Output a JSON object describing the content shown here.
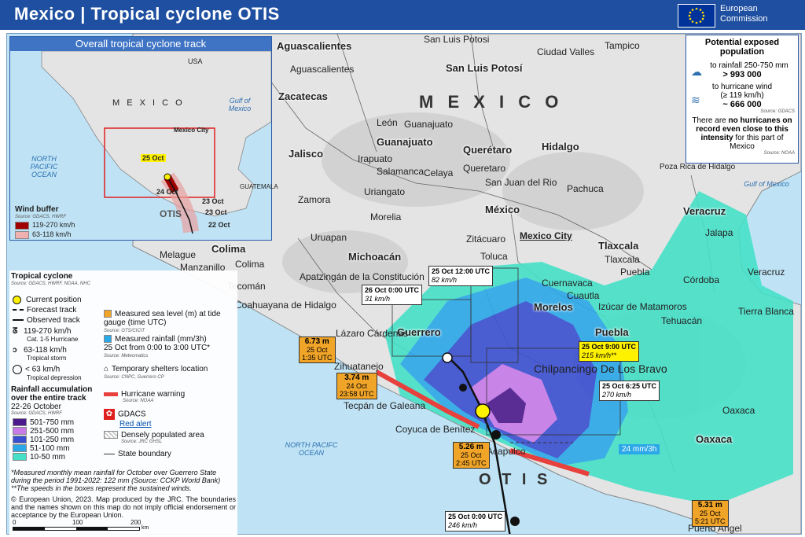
{
  "header": {
    "title": "Mexico | Tropical cyclone  OTIS",
    "eu_line1": "European",
    "eu_line2": "Commission"
  },
  "inset": {
    "title": "Overall tropical cyclone track",
    "country": "M E X I C O",
    "usa": "USA",
    "gulf": "Gulf of Mexico",
    "ocean": "NORTH PACIFIC OCEAN",
    "mexico_city": "Mexico City",
    "guatemala": "GUATEMALA",
    "storm_name": "OTIS",
    "dates": [
      "25 Oct",
      "24 Oct",
      "23 Oct",
      "23 Oct",
      "22 Oct"
    ],
    "wind_title": "Wind buffer",
    "wind_source": "Source: GDACS, HWRF",
    "wind_items": [
      "119-270 km/h",
      "63-118 km/h"
    ]
  },
  "population": {
    "title": "Potential exposed population",
    "rain_label": "to rainfall 250-750 mm",
    "rain_value": "> 993 000",
    "wind_label": "to hurricane wind",
    "wind_sub": "(≥ 119 km/h)",
    "wind_value": "~ 666 000",
    "source1": "Source: GDACS",
    "note1": "There are",
    "note2": "no hurricanes on record even close to this intensity",
    "note3": "for this part of Mexico",
    "source2": "Source: NOAA"
  },
  "map_labels": {
    "country": "M E X I C O",
    "states": [
      "Aguascalientes",
      "San Luis Potosí",
      "Zacatecas",
      "Guanajuato",
      "Querétaro",
      "Hidalgo",
      "Jalisco",
      "Michoacán",
      "México",
      "Tlaxcala",
      "Colima",
      "Morelos",
      "Guerrero",
      "Puebla",
      "Veracruz",
      "Oaxaca"
    ],
    "cities": [
      "San Luis Potosi",
      "Ciudad Valles",
      "Tampico",
      "Aguascalientes",
      "León",
      "Guanajuato",
      "Irapuato",
      "Salamanca",
      "Celaya",
      "Queretaro",
      "San Juan del Rio",
      "Pachuca",
      "Poza Rica de Hidalgo",
      "Zamora",
      "Uriangato",
      "Morelia",
      "Uruapan",
      "Zitácuaro",
      "Toluca",
      "Mexico City",
      "Tlaxcala",
      "Jalapa",
      "Melague",
      "Manzanillo",
      "Colima",
      "Tecomán",
      "Coahuayana de Hidalgo",
      "Apatzingán de la Constitución",
      "Cuernavaca",
      "Cuautla",
      "Puebla",
      "Córdoba",
      "Veracruz",
      "Izúcar de Matamoros",
      "Tehuacán",
      "Tierra Blanca",
      "Lázaro Cárdenas",
      "Zihuatanejo",
      "Chilpancingo De Los Bravo",
      "Tecpán de Galeana",
      "Coyuca de Benítez",
      "Acapulco",
      "Oaxaca",
      "Puerto Angel"
    ],
    "gulf": "Gulf of Mexico",
    "pacific": "NORTH PACIFC OCEAN",
    "otis": "O T I S",
    "rain_rate": "24 mm/3h"
  },
  "callouts": [
    {
      "time": "25 Oct 12:00 UTC",
      "speed": "82 km/h"
    },
    {
      "time": "26 Oct 0:00 UTC",
      "speed": "31 km/h"
    },
    {
      "time": "25 Oct 9:00 UTC",
      "speed": "215 km/h**"
    },
    {
      "time": "25 Oct 6:25 UTC",
      "speed": "270 km/h"
    },
    {
      "time": "25 Oct 0:00 UTC",
      "speed": "246 km/h"
    }
  ],
  "tide_gauges": [
    {
      "value": "6.73 m",
      "date": "25 Oct",
      "time": "1:35 UTC"
    },
    {
      "value": "3.74 m",
      "date": "24 Oct",
      "time": "23:58 UTC"
    },
    {
      "value": "5.26 m",
      "date": "25 Oct",
      "time": "2:45 UTC"
    },
    {
      "value": "5.31 m",
      "date": "25 Oct",
      "time": "5:21 UTC"
    }
  ],
  "legend": {
    "tc_title": "Tropical cyclone",
    "tc_source": "Source: GDACS, HWRF, NOAA, NHC",
    "current": "Current position",
    "forecast": "Forecast track",
    "observed": "Observed track",
    "hurricane": "119-270 km/h",
    "hurricane_sub": "Cat. 1-5 Hurricane",
    "storm": "63-118 km/h",
    "storm_sub": "Tropical storm",
    "depression": "< 63 km/h",
    "depression_sub": "Tropical depression",
    "rain_title": "Rainfall accumulation over the entire track",
    "rain_period": "22-26 October",
    "rain_source": "Source: GDACS, HWRF",
    "rain_items": [
      "501-750 mm",
      "251-500 mm",
      "101-250 mm",
      "51-100 mm",
      "10-50 mm"
    ],
    "sea_level": "Measured sea level (m) at tide gauge (time UTC)",
    "sea_source": "Source: GTS/CICIT",
    "meas_rain": "Measured rainfall (mm/3h)",
    "meas_rain2": "25 Oct from 0:00 to 3:00 UTC*",
    "meas_source": "Source: Meteomatics",
    "shelters": "Temporary shelters location",
    "shelters_source": "Source: CNPC, Guerrero CP",
    "warning": "Hurricane warning",
    "warning_source": "Source: NOAA",
    "gdacs": "GDACS",
    "red_alert": "Red alert",
    "dense": "Densely populated area",
    "dense_source": "Source: JRC GHSL",
    "boundary": "State boundary",
    "note1": "*Measured monthly mean rainfall for October over Guerrero State during the period 1991-2022: 122 mm (Source: CCKP World Bank)",
    "note2": "**The speeds in the boxes represent the sustained winds.",
    "copyright": "© European Union, 2023. Map produced by the JRC. The boundaries and the names shown on this map do not imply official endorsement or acceptance by the European Union.",
    "scale": [
      "0",
      "100",
      "200"
    ],
    "scale_unit": "km"
  },
  "colors": {
    "header": "#1f4fa0",
    "r501": "#4b1a8c",
    "r251": "#c77ae8",
    "r101": "#3a4fd0",
    "r51": "#2ba8e8",
    "r10": "#46e0c8",
    "warning": "#e8403c"
  }
}
